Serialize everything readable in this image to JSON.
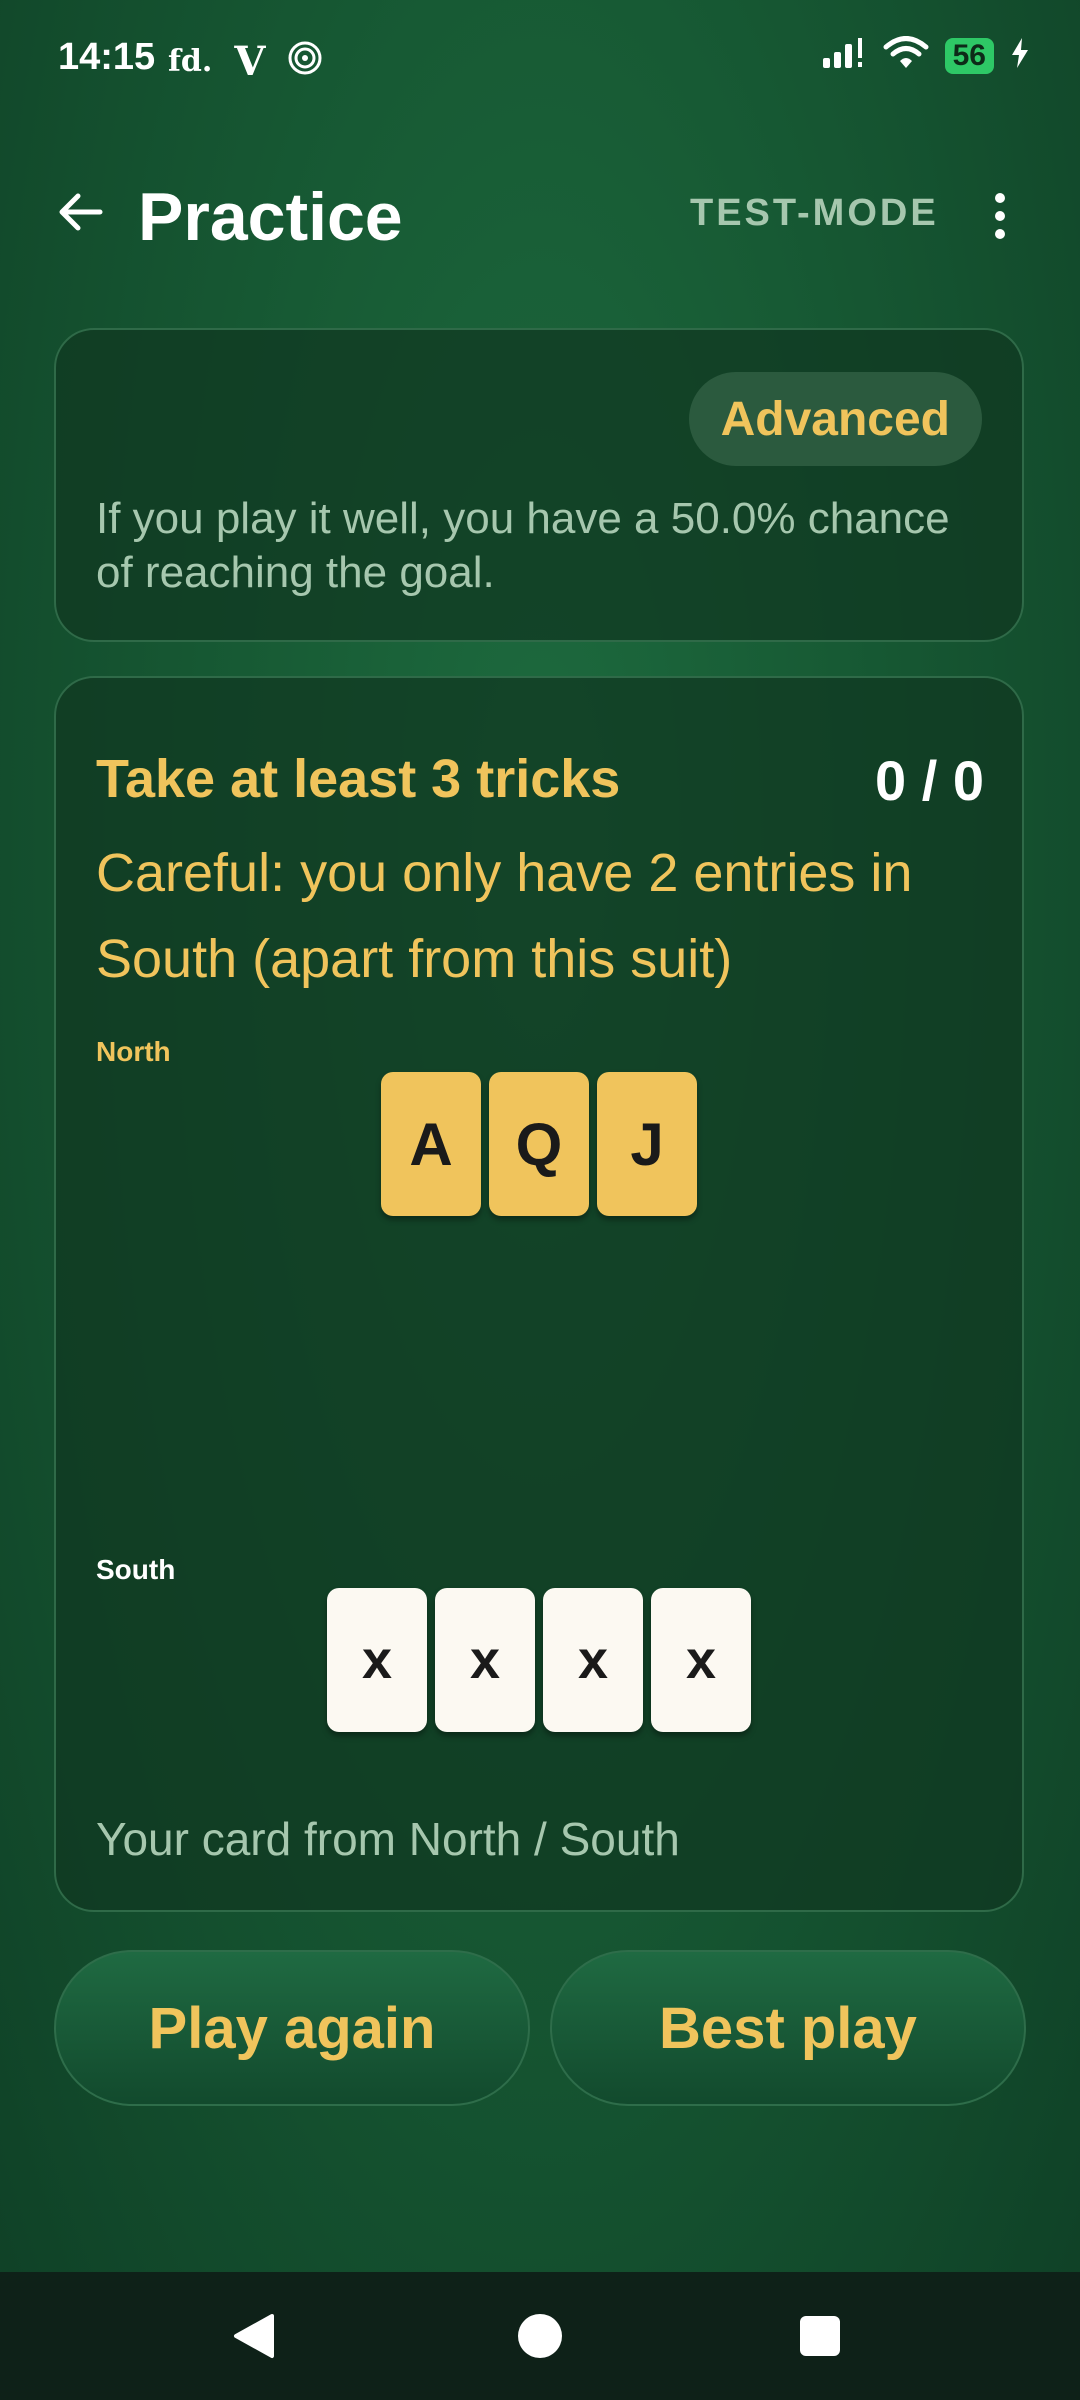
{
  "status_bar": {
    "time": "14:15",
    "left_icons": [
      "fd-icon",
      "v-icon",
      "spiral-icon"
    ],
    "fd_text": "fd.",
    "v_text": "V",
    "battery": "56"
  },
  "app_bar": {
    "title": "Practice",
    "mode_label": "TEST-MODE"
  },
  "info_card": {
    "level": "Advanced",
    "chance_text": "If you play it well, you have a 50.0% chance of reaching the goal."
  },
  "problem_card": {
    "goal": "Take at least 3 tricks",
    "score": "0 / 0",
    "warning": "Careful: you only have 2 entries in South (apart from this suit)",
    "north": {
      "label": "North",
      "cards": [
        "A",
        "Q",
        "J"
      ]
    },
    "south": {
      "label": "South",
      "cards": [
        "x",
        "x",
        "x",
        "x"
      ]
    },
    "hint": "Your card from North / South"
  },
  "actions": {
    "play_again": "Play again",
    "best_play": "Best play"
  },
  "colors": {
    "accent": "#f0c45c",
    "background": "#175a34",
    "muted_text": "#a6c7ae"
  }
}
